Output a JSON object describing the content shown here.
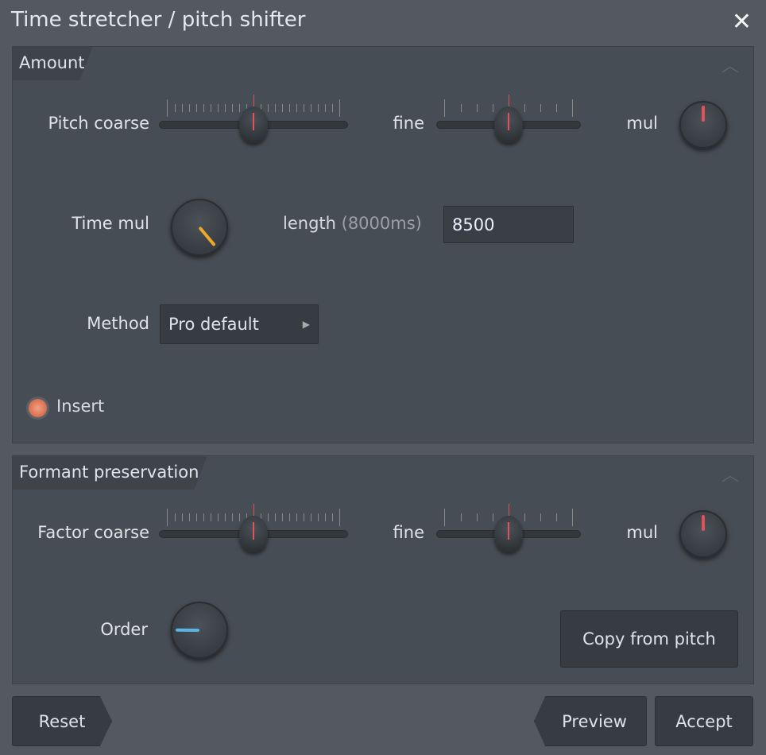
{
  "window": {
    "title": "Time stretcher / pitch shifter",
    "close_icon": "close-icon"
  },
  "amount": {
    "header": "Amount",
    "pitch_coarse_label": "Pitch coarse",
    "pitch_coarse_value": 0.5,
    "fine_label": "fine",
    "fine_value": 0.5,
    "mul_label": "mul",
    "mul_value": 0.5,
    "time_mul_label": "Time mul",
    "time_mul_value": 1.0,
    "length_label": "length",
    "length_hint": "(8000ms)",
    "length_value": "8500",
    "method_label": "Method",
    "method_value": "Pro default",
    "insert_label": "Insert"
  },
  "formant": {
    "header": "Formant preservation",
    "factor_coarse_label": "Factor coarse",
    "factor_coarse_value": 0.5,
    "fine_label": "fine",
    "fine_value": 0.5,
    "mul_label": "mul",
    "mul_value": 0.5,
    "order_label": "Order",
    "order_value": 0.18,
    "copy_button": "Copy from pitch"
  },
  "footer": {
    "reset": "Reset",
    "preview": "Preview",
    "accept": "Accept"
  },
  "colors": {
    "pitch_indicator": "#e2525a",
    "time_indicator": "#f0a82a",
    "order_indicator": "#5ab4e6",
    "insert_led": "#e8785a"
  }
}
